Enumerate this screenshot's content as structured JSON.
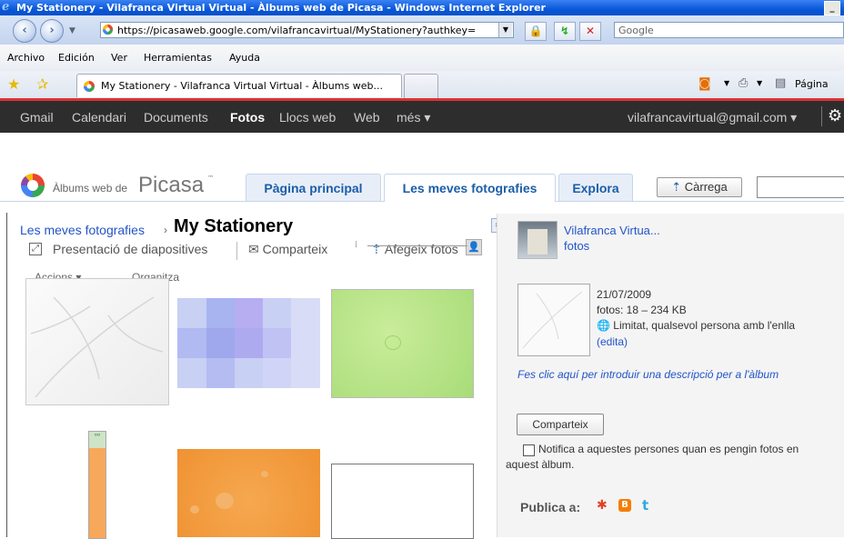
{
  "window": {
    "title": "My Stationery - Vilafranca Virtual Virtual - Àlbums web de Picasa - Windows Internet Explorer",
    "address": "https://picasaweb.google.com/vilafrancavirtual/MyStationery?authkey=",
    "search_placeholder": "Google",
    "menu": [
      "Archivo",
      "Edición",
      "Ver",
      "Herramientas",
      "Ayuda"
    ],
    "tab_title": "My Stationery - Vilafranca Virtual Virtual - Àlbums web...",
    "page_menu": "Página"
  },
  "gbar": {
    "links": [
      "Gmail",
      "Calendari",
      "Documents",
      "Fotos",
      "Llocs web",
      "Web",
      "més"
    ],
    "active": "Fotos",
    "account": "vilafrancavirtual@gmail.com"
  },
  "picasa": {
    "logo_prefix": "Àlbums web de",
    "logo_word": "Picasa",
    "tabs": [
      "Pàgina principal",
      "Les meves fotografies",
      "Explora"
    ],
    "active_tab": "Les meves fotografies",
    "upload": "Càrrega"
  },
  "album": {
    "breadcrumb_parent": "Les meves fotografies",
    "breadcrumb_sep": "›",
    "title": "My Stationery",
    "actions": {
      "slideshow": "Presentació de diapositives",
      "share": "Comparteix",
      "add_photos": "Afegeix fotos",
      "actions_menu": "Accions",
      "organize": "Organitza"
    }
  },
  "sidebar": {
    "owner_name": "Vilafranca Virtua...",
    "owner_link": "fotos",
    "date": "21/07/2009",
    "photos": "fotos: 18 – 234 KB",
    "visibility": "Limitat, qualsevol persona amb l'enlla",
    "edit": "(edita)",
    "description_prompt": "Fes clic aquí per introduir una descripció per a l'àlbum",
    "share_button": "Comparteix",
    "notify_label": "Notifica a aquestes persones quan es pengin fotos en aquest àlbum.",
    "publish_label": "Publica a:"
  },
  "colors": {
    "gbar_bg": "#2d2d2d",
    "link": "#2354c8",
    "tab_text": "#1b5ea8"
  }
}
